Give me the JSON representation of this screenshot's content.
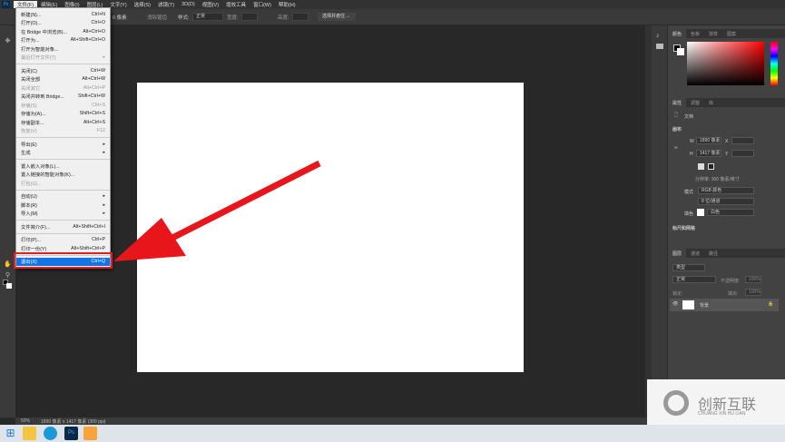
{
  "menubar": {
    "logo": "Ps",
    "items": [
      "文件(F)",
      "编辑(E)",
      "图像(I)",
      "图层(L)",
      "文字(Y)",
      "选择(S)",
      "滤镜(T)",
      "3D(D)",
      "视图(V)",
      "增效工具",
      "窗口(W)",
      "帮助(H)"
    ]
  },
  "options": {
    "size": "0 像素",
    "antialias": "消除锯齿",
    "style_label": "样式:",
    "style_value": "正常",
    "width_label": "宽度:",
    "height_label": "高度:",
    "select_mask": "选择并遮住 ..."
  },
  "file_menu": [
    {
      "label": "新建(N)...",
      "shortcut": "Ctrl+N"
    },
    {
      "label": "打开(O)...",
      "shortcut": "Ctrl+O"
    },
    {
      "label": "在 Bridge 中浏览(B)...",
      "shortcut": "Alt+Ctrl+O"
    },
    {
      "label": "打开为...",
      "shortcut": "Alt+Shift+Ctrl+O"
    },
    {
      "label": "打开为智能对象...",
      "shortcut": ""
    },
    {
      "label": "最近打开文件(T)",
      "shortcut": "",
      "submenu": true,
      "disabled": true
    },
    {
      "sep": true
    },
    {
      "label": "关闭(C)",
      "shortcut": "Ctrl+W"
    },
    {
      "label": "关闭全部",
      "shortcut": "Alt+Ctrl+W"
    },
    {
      "label": "关闭其它",
      "shortcut": "Alt+Ctrl+P",
      "disabled": true
    },
    {
      "label": "关闭并转到 Bridge...",
      "shortcut": "Shift+Ctrl+W"
    },
    {
      "label": "存储(S)",
      "shortcut": "Ctrl+S",
      "disabled": true
    },
    {
      "label": "存储为(A)...",
      "shortcut": "Shift+Ctrl+S"
    },
    {
      "label": "存储副本...",
      "shortcut": "Alt+Ctrl+S"
    },
    {
      "label": "恢复(V)",
      "shortcut": "F12",
      "disabled": true
    },
    {
      "sep": true
    },
    {
      "label": "导出(E)",
      "shortcut": "",
      "submenu": true
    },
    {
      "label": "生成",
      "shortcut": "",
      "submenu": true
    },
    {
      "sep": true
    },
    {
      "label": "置入嵌入对象(L)...",
      "shortcut": ""
    },
    {
      "label": "置入链接的智能对象(K)...",
      "shortcut": ""
    },
    {
      "label": "打包(G)...",
      "shortcut": "",
      "disabled": true
    },
    {
      "sep": true
    },
    {
      "label": "自动(U)",
      "shortcut": "",
      "submenu": true
    },
    {
      "label": "脚本(R)",
      "shortcut": "",
      "submenu": true
    },
    {
      "label": "导入(M)",
      "shortcut": "",
      "submenu": true
    },
    {
      "sep": true
    },
    {
      "label": "文件简介(F)...",
      "shortcut": "Alt+Shift+Ctrl+I"
    },
    {
      "sep": true
    },
    {
      "label": "打印(P)...",
      "shortcut": "Ctrl+P"
    },
    {
      "label": "打印一份(Y)",
      "shortcut": "Alt+Shift+Ctrl+P"
    },
    {
      "sep": true
    },
    {
      "label": "退出(X)",
      "shortcut": "Ctrl+Q",
      "highlighted": true
    }
  ],
  "color_panel": {
    "tabs": [
      "颜色",
      "色板",
      "渐变",
      "图案"
    ]
  },
  "properties_panel": {
    "tabs": [
      "属性",
      "调整",
      "库"
    ],
    "doc_label": "文档",
    "canvas_section": "画布",
    "w_label": "W",
    "w_value": "1890 像素",
    "h_label": "H",
    "h_value": "1417 像素",
    "x_label": "X",
    "y_label": "Y",
    "resolution": "分辨率: 300 像素/英寸",
    "mode_label": "模式",
    "mode_value": "RGB 颜色",
    "depth_value": "8 位/通道",
    "fill_label": "填色",
    "fill_value": "白色",
    "rulers_section": "标尺和网格"
  },
  "layers_panel": {
    "tabs": [
      "图层",
      "通道",
      "路径"
    ],
    "search": "类型",
    "blend": "正常",
    "opacity_label": "不透明度:",
    "opacity": "100%",
    "lock_label": "锁定:",
    "fill_label": "填充:",
    "fill": "100%",
    "layer_name": "背景"
  },
  "status": {
    "zoom": "50%",
    "info": "1890 像素 x 1417 像素 (300 ppi)"
  },
  "watermark": {
    "name": "创新互联",
    "pinyin": "CHUANG XIN HU LIAN"
  },
  "colors": {
    "highlight": "#1473e6",
    "annotation": "#e02020"
  }
}
